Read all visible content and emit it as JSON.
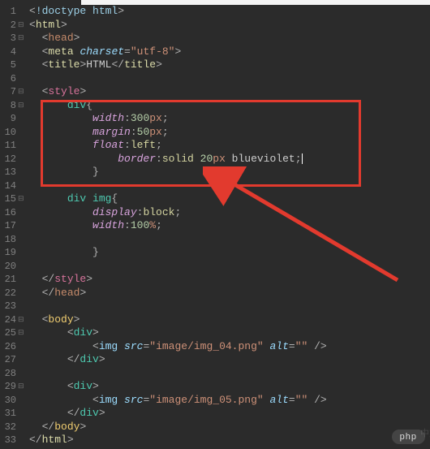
{
  "lines": [
    {
      "n": 1,
      "s": [
        [
          "punct",
          "<"
        ],
        [
          "doctype",
          "!doctype html"
        ],
        [
          "punct",
          ">"
        ]
      ]
    },
    {
      "n": 2,
      "fold": "⊟",
      "s": [
        [
          "punct",
          "<"
        ],
        [
          "tag",
          "html"
        ],
        [
          "punct",
          ">"
        ]
      ]
    },
    {
      "n": 3,
      "fold": "⊟",
      "s": [
        [
          "str",
          "  "
        ],
        [
          "punct",
          "<"
        ],
        [
          "head-tag",
          "head"
        ],
        [
          "punct",
          ">"
        ]
      ]
    },
    {
      "n": 4,
      "s": [
        [
          "str",
          "  "
        ],
        [
          "punct",
          "<"
        ],
        [
          "tag",
          "meta "
        ],
        [
          "attr",
          "charset"
        ],
        [
          "punct",
          "="
        ],
        [
          "str",
          "\"utf-8\""
        ],
        [
          "punct",
          ">"
        ]
      ]
    },
    {
      "n": 5,
      "s": [
        [
          "str",
          "  "
        ],
        [
          "punct",
          "<"
        ],
        [
          "tag",
          "title"
        ],
        [
          "punct",
          ">"
        ],
        [
          "val-color",
          "HTML"
        ],
        [
          "punct",
          "</"
        ],
        [
          "tag",
          "title"
        ],
        [
          "punct",
          ">"
        ]
      ]
    },
    {
      "n": 6,
      "s": [
        [
          "str",
          ""
        ]
      ]
    },
    {
      "n": 7,
      "fold": "⊟",
      "s": [
        [
          "str",
          "  "
        ],
        [
          "punct",
          "<"
        ],
        [
          "style-tag",
          "style"
        ],
        [
          "punct",
          ">"
        ]
      ]
    },
    {
      "n": 8,
      "fold": "⊟",
      "s": [
        [
          "str",
          "      "
        ],
        [
          "selector-div",
          "div"
        ],
        [
          "punct",
          "{"
        ]
      ]
    },
    {
      "n": 9,
      "s": [
        [
          "str",
          "          "
        ],
        [
          "prop",
          "width"
        ],
        [
          "punct",
          ":"
        ],
        [
          "val-num",
          "300"
        ],
        [
          "val-px",
          "px"
        ],
        [
          "punct",
          ";"
        ]
      ]
    },
    {
      "n": 10,
      "s": [
        [
          "str",
          "          "
        ],
        [
          "prop",
          "margin"
        ],
        [
          "punct",
          ":"
        ],
        [
          "val-num",
          "50"
        ],
        [
          "val-px",
          "px"
        ],
        [
          "punct",
          ";"
        ]
      ]
    },
    {
      "n": 11,
      "s": [
        [
          "str",
          "          "
        ],
        [
          "prop",
          "float"
        ],
        [
          "punct",
          ":"
        ],
        [
          "val-kw",
          "left"
        ],
        [
          "punct",
          ";"
        ]
      ]
    },
    {
      "n": 12,
      "s": [
        [
          "str",
          "              "
        ],
        [
          "prop",
          "border"
        ],
        [
          "punct",
          ":"
        ],
        [
          "val-kw",
          "solid "
        ],
        [
          "val-num",
          "20"
        ],
        [
          "val-px",
          "px "
        ],
        [
          "val-color",
          "blueviolet"
        ],
        [
          "punct",
          ";"
        ],
        [
          "cursor",
          ""
        ]
      ]
    },
    {
      "n": 13,
      "s": [
        [
          "str",
          "          "
        ],
        [
          "punct",
          "}"
        ]
      ]
    },
    {
      "n": 14,
      "s": [
        [
          "str",
          ""
        ]
      ]
    },
    {
      "n": 15,
      "fold": "⊟",
      "s": [
        [
          "str",
          "      "
        ],
        [
          "selector-div",
          "div img"
        ],
        [
          "punct",
          "{"
        ]
      ]
    },
    {
      "n": 16,
      "s": [
        [
          "str",
          "          "
        ],
        [
          "prop",
          "display"
        ],
        [
          "punct",
          ":"
        ],
        [
          "val-kw",
          "block"
        ],
        [
          "punct",
          ";"
        ]
      ]
    },
    {
      "n": 17,
      "s": [
        [
          "str",
          "          "
        ],
        [
          "prop",
          "width"
        ],
        [
          "punct",
          ":"
        ],
        [
          "val-num",
          "100"
        ],
        [
          "val-px",
          "%"
        ],
        [
          "punct",
          ";"
        ]
      ]
    },
    {
      "n": 18,
      "s": [
        [
          "str",
          ""
        ]
      ]
    },
    {
      "n": 19,
      "s": [
        [
          "str",
          "          "
        ],
        [
          "punct",
          "}"
        ]
      ]
    },
    {
      "n": 20,
      "s": [
        [
          "str",
          ""
        ]
      ]
    },
    {
      "n": 21,
      "s": [
        [
          "str",
          "  "
        ],
        [
          "punct",
          "</"
        ],
        [
          "style-tag",
          "style"
        ],
        [
          "punct",
          ">"
        ]
      ]
    },
    {
      "n": 22,
      "s": [
        [
          "str",
          "  "
        ],
        [
          "punct",
          "</"
        ],
        [
          "head-tag",
          "head"
        ],
        [
          "punct",
          ">"
        ]
      ]
    },
    {
      "n": 23,
      "s": [
        [
          "str",
          ""
        ]
      ]
    },
    {
      "n": 24,
      "fold": "⊟",
      "s": [
        [
          "str",
          "  "
        ],
        [
          "punct",
          "<"
        ],
        [
          "body-tag",
          "body"
        ],
        [
          "punct",
          ">"
        ]
      ]
    },
    {
      "n": 25,
      "fold": "⊟",
      "s": [
        [
          "str",
          "      "
        ],
        [
          "punct",
          "<"
        ],
        [
          "div-tag",
          "div"
        ],
        [
          "punct",
          ">"
        ]
      ]
    },
    {
      "n": 26,
      "s": [
        [
          "str",
          "          "
        ],
        [
          "punct",
          "<"
        ],
        [
          "img-tag",
          "img "
        ],
        [
          "attr",
          "src"
        ],
        [
          "punct",
          "="
        ],
        [
          "str",
          "\"image/img_04.png\" "
        ],
        [
          "attr",
          "alt"
        ],
        [
          "punct",
          "="
        ],
        [
          "str",
          "\"\" "
        ],
        [
          "punct",
          "/>"
        ]
      ]
    },
    {
      "n": 27,
      "s": [
        [
          "str",
          "      "
        ],
        [
          "punct",
          "</"
        ],
        [
          "div-tag",
          "div"
        ],
        [
          "punct",
          ">"
        ]
      ]
    },
    {
      "n": 28,
      "s": [
        [
          "str",
          ""
        ]
      ]
    },
    {
      "n": 29,
      "fold": "⊟",
      "s": [
        [
          "str",
          "      "
        ],
        [
          "punct",
          "<"
        ],
        [
          "div-tag",
          "div"
        ],
        [
          "punct",
          ">"
        ]
      ]
    },
    {
      "n": 30,
      "s": [
        [
          "str",
          "          "
        ],
        [
          "punct",
          "<"
        ],
        [
          "img-tag",
          "img "
        ],
        [
          "attr",
          "src"
        ],
        [
          "punct",
          "="
        ],
        [
          "str",
          "\"image/img_05.png\" "
        ],
        [
          "attr",
          "alt"
        ],
        [
          "punct",
          "="
        ],
        [
          "str",
          "\"\" "
        ],
        [
          "punct",
          "/>"
        ]
      ]
    },
    {
      "n": 31,
      "s": [
        [
          "str",
          "      "
        ],
        [
          "punct",
          "</"
        ],
        [
          "div-tag",
          "div"
        ],
        [
          "punct",
          ">"
        ]
      ]
    },
    {
      "n": 32,
      "s": [
        [
          "str",
          "  "
        ],
        [
          "punct",
          "</"
        ],
        [
          "body-tag",
          "body"
        ],
        [
          "punct",
          ">"
        ]
      ]
    },
    {
      "n": 33,
      "s": [
        [
          "punct",
          "</"
        ],
        [
          "tag",
          "html"
        ],
        [
          "punct",
          ">"
        ]
      ]
    }
  ],
  "watermark": "php",
  "watermark2": "中文"
}
